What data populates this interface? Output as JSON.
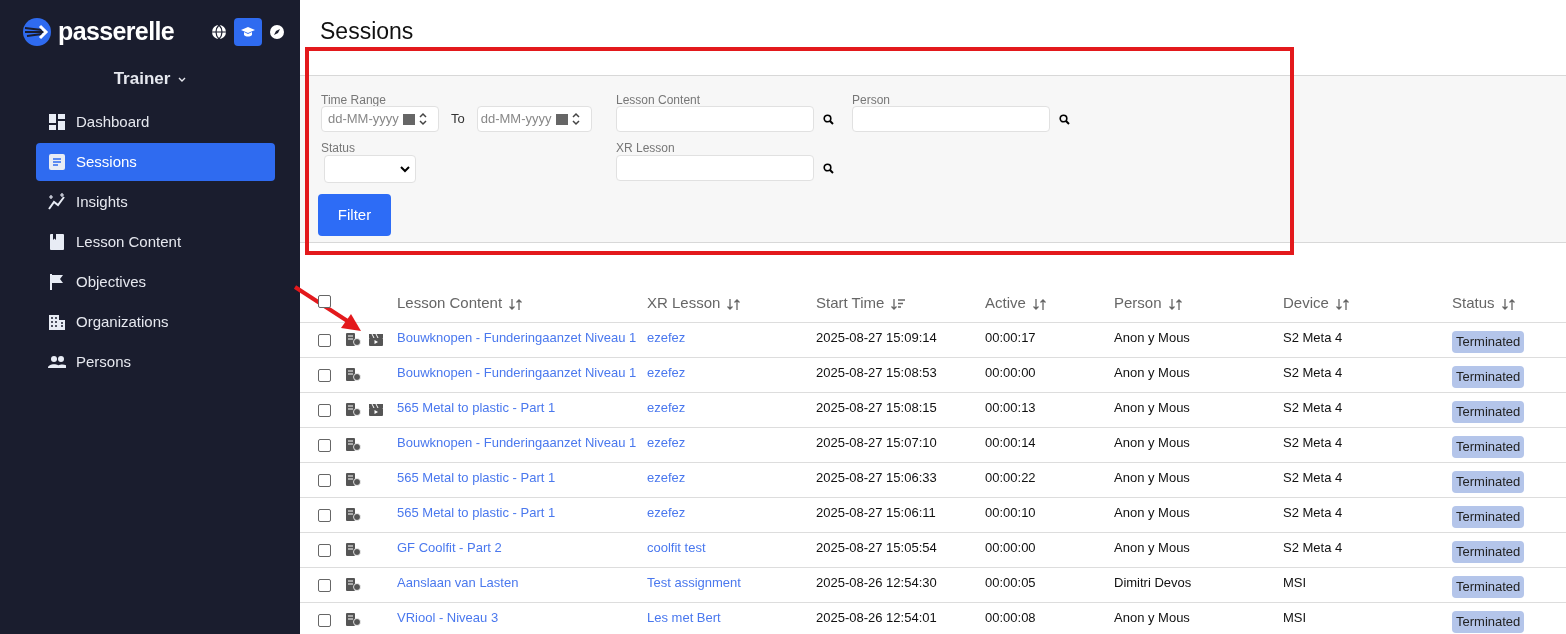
{
  "sidebar": {
    "brand": "passerelle",
    "modes": [
      {
        "kind": "globe",
        "selected": false
      },
      {
        "kind": "cap",
        "selected": true
      },
      {
        "kind": "compass",
        "selected": false
      }
    ],
    "role": "Trainer",
    "items": [
      {
        "kind": "dashboard",
        "label": "Dashboard",
        "selected": false
      },
      {
        "kind": "sessions",
        "label": "Sessions",
        "selected": true
      },
      {
        "kind": "insights",
        "label": "Insights",
        "selected": false
      },
      {
        "kind": "book",
        "label": "Lesson Content",
        "selected": false
      },
      {
        "kind": "flag",
        "label": "Objectives",
        "selected": false
      },
      {
        "kind": "building",
        "label": "Organizations",
        "selected": false
      },
      {
        "kind": "people",
        "label": "Persons",
        "selected": false
      }
    ]
  },
  "page_title": "Sessions",
  "filters": {
    "time_range_label": "Time Range",
    "from_placeholder": "dd-MM-yyyy",
    "to_label": "To",
    "to_placeholder": "dd-MM-yyyy",
    "status_label": "Status",
    "lesson_content_label": "Lesson Content",
    "xr_lesson_label": "XR Lesson",
    "person_label": "Person",
    "filter_button": "Filter"
  },
  "table": {
    "select_all_checked": false,
    "columns": [
      {
        "label": "Lesson Content",
        "sorted": false
      },
      {
        "label": "XR Lesson",
        "sorted": false
      },
      {
        "label": "Start Time",
        "sorted": true
      },
      {
        "label": "Active",
        "sorted": false
      },
      {
        "label": "Person",
        "sorted": false
      },
      {
        "label": "Device",
        "sorted": false
      },
      {
        "label": "Status",
        "sorted": false
      }
    ],
    "rows": [
      {
        "checked": false,
        "video": true,
        "lesson_content": "Bouwknopen - Funderingaanzet Niveau 1",
        "xr_lesson": "ezefez",
        "start_time": "2025-08-27 15:09:14",
        "active": "00:00:17",
        "person": "Anon y Mous",
        "device": "S2 Meta 4",
        "status": "Terminated"
      },
      {
        "checked": false,
        "video": false,
        "lesson_content": "Bouwknopen - Funderingaanzet Niveau 1",
        "xr_lesson": "ezefez",
        "start_time": "2025-08-27 15:08:53",
        "active": "00:00:00",
        "person": "Anon y Mous",
        "device": "S2 Meta 4",
        "status": "Terminated"
      },
      {
        "checked": false,
        "video": true,
        "lesson_content": "565 Metal to plastic - Part 1",
        "xr_lesson": "ezefez",
        "start_time": "2025-08-27 15:08:15",
        "active": "00:00:13",
        "person": "Anon y Mous",
        "device": "S2 Meta 4",
        "status": "Terminated"
      },
      {
        "checked": false,
        "video": false,
        "lesson_content": "Bouwknopen - Funderingaanzet Niveau 1",
        "xr_lesson": "ezefez",
        "start_time": "2025-08-27 15:07:10",
        "active": "00:00:14",
        "person": "Anon y Mous",
        "device": "S2 Meta 4",
        "status": "Terminated"
      },
      {
        "checked": false,
        "video": false,
        "lesson_content": "565 Metal to plastic - Part 1",
        "xr_lesson": "ezefez",
        "start_time": "2025-08-27 15:06:33",
        "active": "00:00:22",
        "person": "Anon y Mous",
        "device": "S2 Meta 4",
        "status": "Terminated"
      },
      {
        "checked": false,
        "video": false,
        "lesson_content": "565 Metal to plastic - Part 1",
        "xr_lesson": "ezefez",
        "start_time": "2025-08-27 15:06:11",
        "active": "00:00:10",
        "person": "Anon y Mous",
        "device": "S2 Meta 4",
        "status": "Terminated"
      },
      {
        "checked": false,
        "video": false,
        "lesson_content": "GF Coolfit - Part 2",
        "xr_lesson": "coolfit test",
        "start_time": "2025-08-27 15:05:54",
        "active": "00:00:00",
        "person": "Anon y Mous",
        "device": "S2 Meta 4",
        "status": "Terminated"
      },
      {
        "checked": false,
        "video": false,
        "lesson_content": "Aanslaan van Lasten",
        "xr_lesson": "Test assignment",
        "start_time": "2025-08-26 12:54:30",
        "active": "00:00:05",
        "person": "Dimitri Devos",
        "device": "MSI",
        "status": "Terminated"
      },
      {
        "checked": false,
        "video": false,
        "lesson_content": "VRiool - Niveau 3",
        "xr_lesson": "Les met Bert",
        "start_time": "2025-08-26 12:54:01",
        "active": "00:00:08",
        "person": "Anon y Mous",
        "device": "MSI",
        "status": "Terminated"
      }
    ]
  }
}
